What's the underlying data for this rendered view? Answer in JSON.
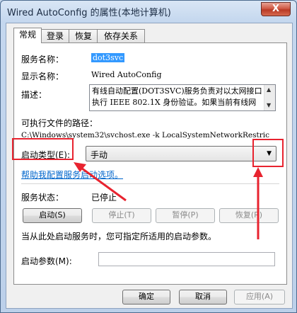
{
  "window": {
    "title": "Wired AutoConfig 的属性(本地计算机)",
    "close_label": "X"
  },
  "tabs": [
    {
      "label": "常规",
      "active": true
    },
    {
      "label": "登录",
      "active": false
    },
    {
      "label": "恢复",
      "active": false
    },
    {
      "label": "依存关系",
      "active": false
    }
  ],
  "general": {
    "service_name_label": "服务名称：",
    "service_name_value": "dot3svc",
    "display_name_label": "显示名称：",
    "display_name_value": "Wired AutoConfig",
    "description_label": "描述：",
    "description_line1": "有线自动配置(DOT3SVC)服务负责对以太网接口",
    "description_line2": "执行 IEEE 802.1X 身份验证。如果当前有线网",
    "exe_path_label": "可执行文件的路径：",
    "exe_path_value": "C:\\Windows\\system32\\svchost.exe -k LocalSystemNetworkRestric",
    "startup_type_label": "启动类型(E):",
    "startup_type_value": "手动",
    "help_link": "帮助我配置服务启动选项。",
    "status_label": "服务状态：",
    "status_value": "已停止",
    "start_button": "启动(S)",
    "stop_button": "停止(T)",
    "pause_button": "暂停(P)",
    "resume_button": "恢复(R)",
    "hint_text": "当从此处启动服务时，您可指定所适用的启动参数。",
    "params_label": "启动参数(M):",
    "params_value": ""
  },
  "footer": {
    "ok_button": "确定",
    "cancel_button": "取消",
    "apply_button": "应用(A)"
  },
  "annotation_color": "#e8232f"
}
